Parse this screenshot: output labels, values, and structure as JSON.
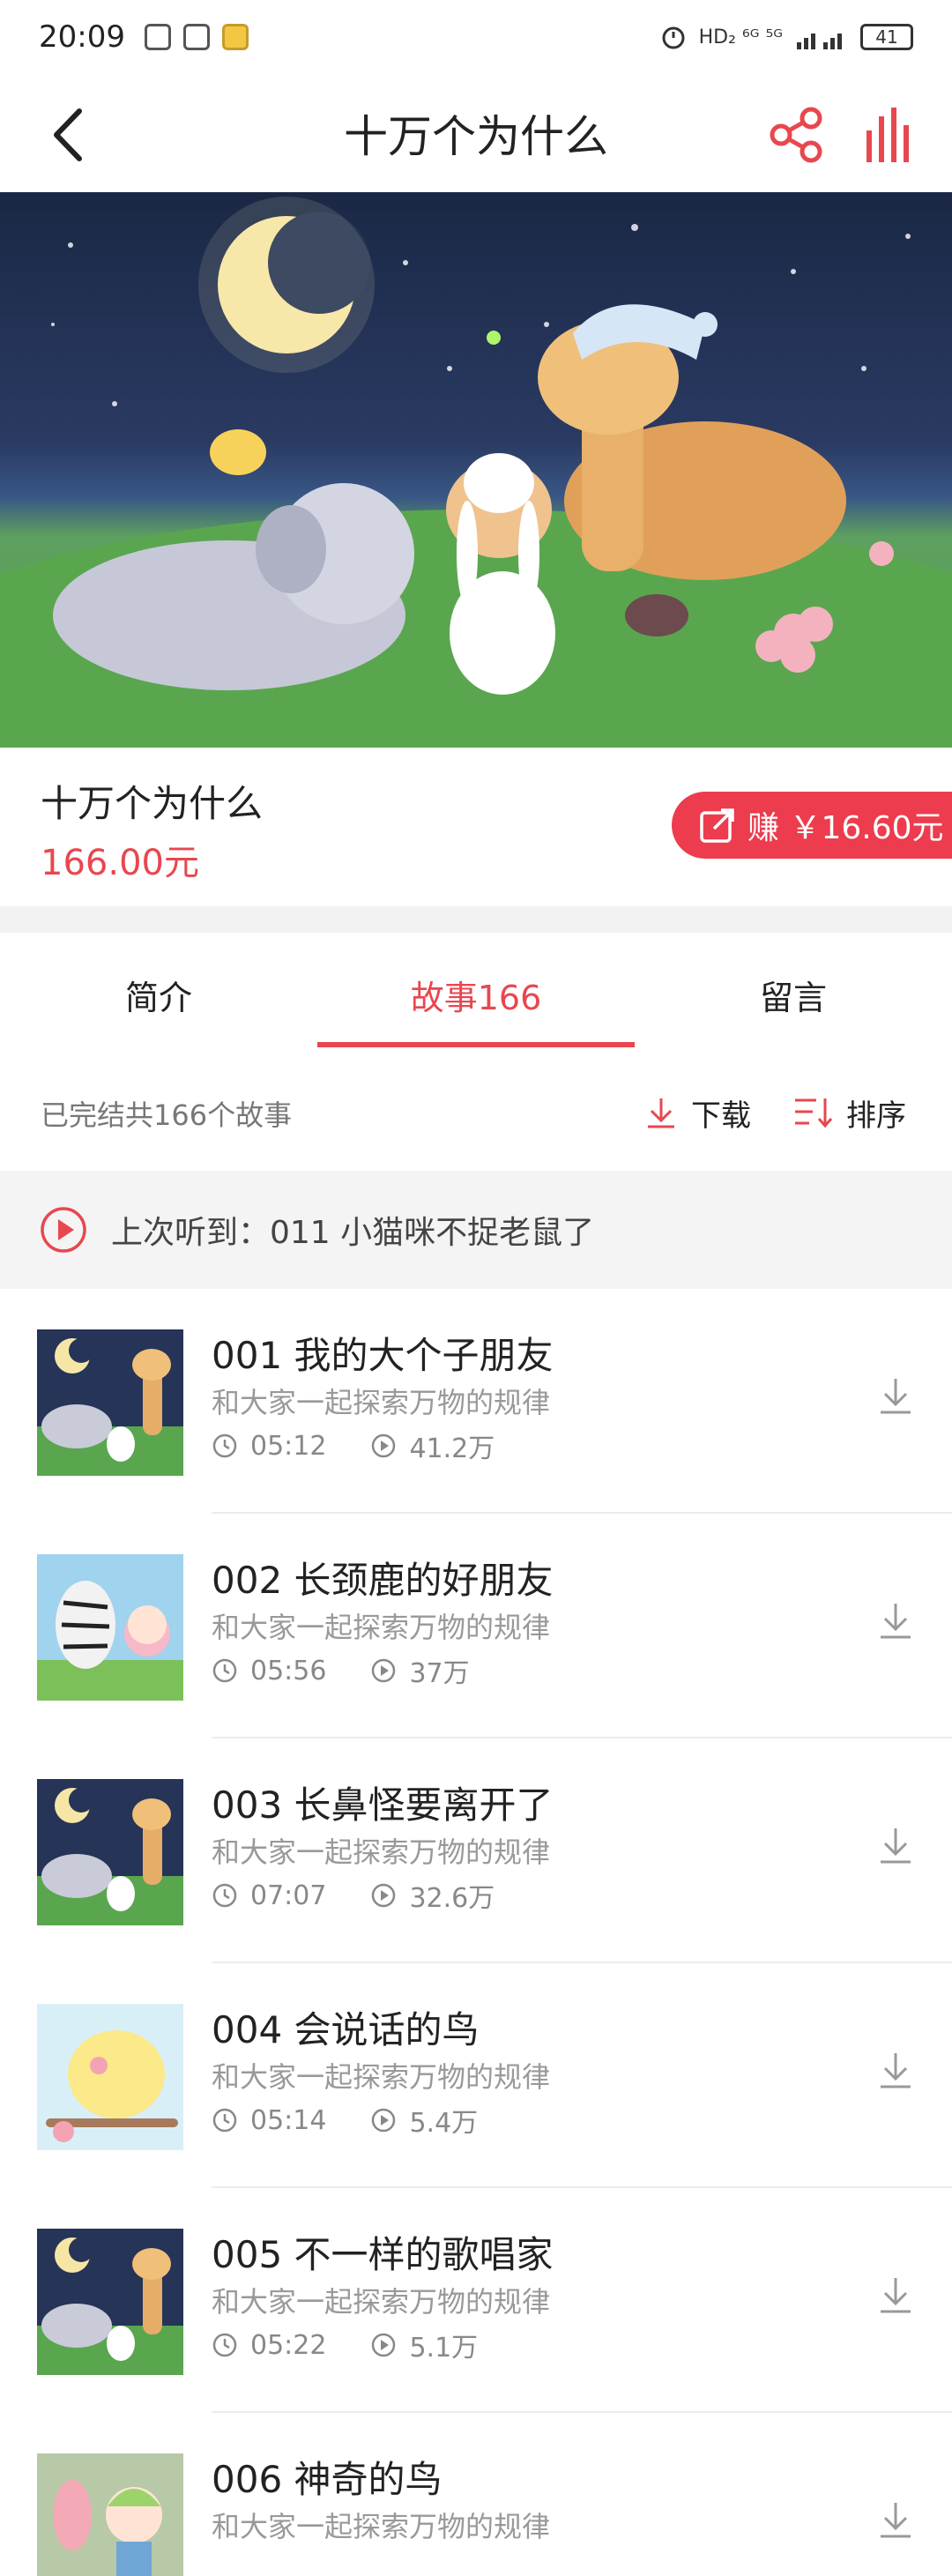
{
  "status": {
    "time": "20:09",
    "indicators": "HD₂  ⁶ᴳ  ⁵ᴳ",
    "battery": "41"
  },
  "header": {
    "title": "十万个为什么"
  },
  "album": {
    "title": "十万个为什么",
    "price": "166.00元",
    "earn_label": "赚 ￥16.60元"
  },
  "tabs": [
    {
      "label": "简介"
    },
    {
      "label": "故事166"
    },
    {
      "label": "留言"
    }
  ],
  "toolbar": {
    "summary": "已完结共166个故事",
    "download_label": "下载",
    "sort_label": "排序"
  },
  "last_played": {
    "text": "上次听到：011  小猫咪不捉老鼠了"
  },
  "episodes": [
    {
      "title": "001  我的大个子朋友",
      "subtitle": "和大家一起探索万物的规律",
      "duration": "05:12",
      "plays": "41.2万",
      "thumb": "night-animals"
    },
    {
      "title": "002  长颈鹿的好朋友",
      "subtitle": "和大家一起探索万物的规律",
      "duration": "05:56",
      "plays": "37万",
      "thumb": "zebra-friends"
    },
    {
      "title": "003  长鼻怪要离开了",
      "subtitle": "和大家一起探索万物的规律",
      "duration": "07:07",
      "plays": "32.6万",
      "thumb": "night-animals"
    },
    {
      "title": "004  会说话的鸟",
      "subtitle": "和大家一起探索万物的规律",
      "duration": "05:14",
      "plays": "5.4万",
      "thumb": "yellow-bird"
    },
    {
      "title": "005  不一样的歌唱家",
      "subtitle": "和大家一起探索万物的规律",
      "duration": "05:22",
      "plays": "5.1万",
      "thumb": "night-animals"
    },
    {
      "title": "006  神奇的鸟",
      "subtitle": "和大家一起探索万物的规律",
      "duration": "",
      "plays": "",
      "thumb": "flamingo-girl"
    }
  ],
  "colors": {
    "accent": "#e8474f",
    "earn_button": "#ec3c4e",
    "last_played_bg": "#f4f4f4"
  }
}
